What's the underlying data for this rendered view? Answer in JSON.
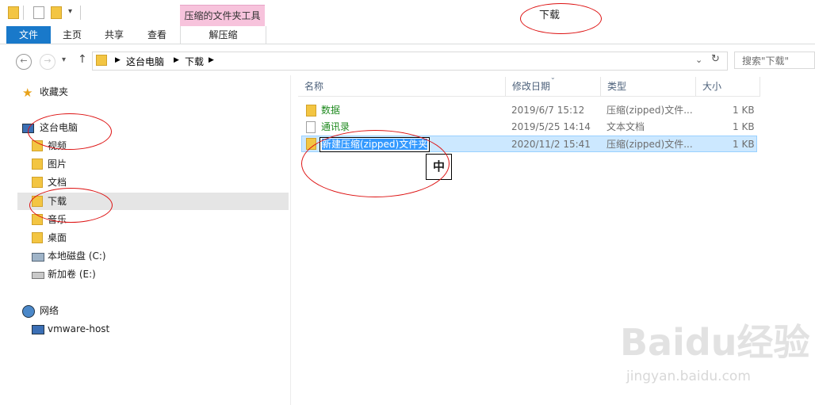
{
  "window": {
    "title": "下载"
  },
  "ribbon": {
    "context_group": "压缩的文件夹工具",
    "tabs": [
      "文件",
      "主页",
      "共享",
      "查看"
    ],
    "context_tab": "解压缩"
  },
  "address": {
    "crumbs": [
      "这台电脑",
      "下载"
    ],
    "search_placeholder": "搜索\"下载\""
  },
  "nav": {
    "favorites": "收藏夹",
    "this_pc": "这台电脑",
    "items": [
      "视频",
      "图片",
      "文档",
      "下载",
      "音乐",
      "桌面",
      "本地磁盘 (C:)",
      "新加卷 (E:)"
    ],
    "network": "网络",
    "network_items": [
      "vmware-host"
    ]
  },
  "list": {
    "columns": [
      "名称",
      "修改日期",
      "类型",
      "大小"
    ],
    "rows": [
      {
        "name": "数据",
        "date": "2019/6/7 15:12",
        "type": "压缩(zipped)文件...",
        "size": "1 KB"
      },
      {
        "name": "通讯录",
        "date": "2019/5/25 14:14",
        "type": "文本文档",
        "size": "1 KB"
      },
      {
        "name": "新建压缩(zipped)文件夹",
        "date": "2020/11/2 15:41",
        "type": "压缩(zipped)文件...",
        "size": "1 KB"
      }
    ]
  },
  "ime": "中",
  "watermark": {
    "brand": "Baidu经验",
    "url": "jingyan.baidu.com"
  },
  "colors": {
    "accent": "#1979ca",
    "context": "#f7c3dc",
    "selection": "#cce8ff",
    "annotation": "#d11111"
  }
}
